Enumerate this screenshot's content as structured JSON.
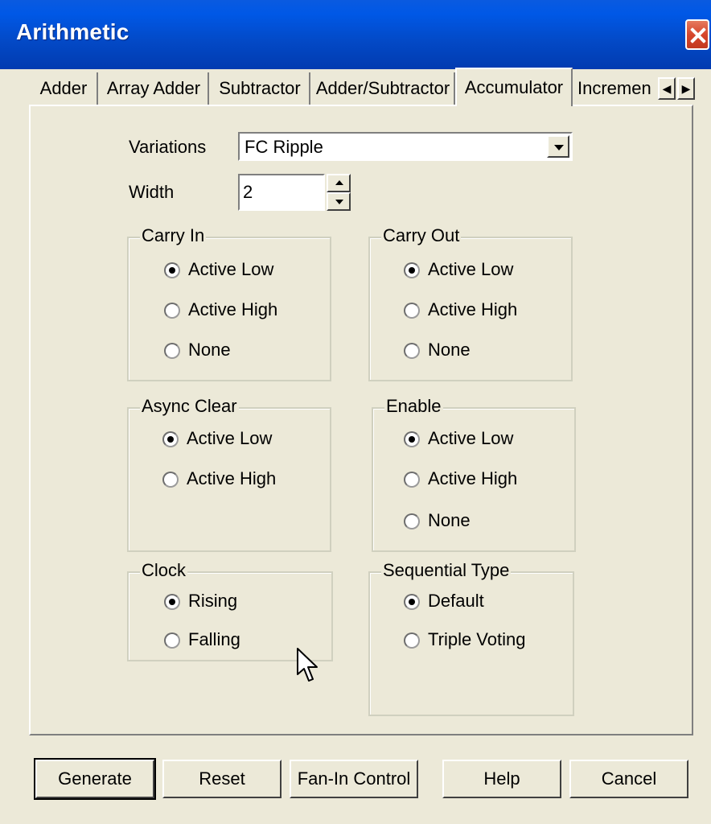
{
  "window": {
    "title": "Arithmetic"
  },
  "tabs": [
    {
      "label": "Adder"
    },
    {
      "label": "Array Adder"
    },
    {
      "label": "Subtractor"
    },
    {
      "label": "Adder/Subtractor"
    },
    {
      "label": "Accumulator",
      "active": true
    },
    {
      "label": "Incremen"
    }
  ],
  "form": {
    "variations_label": "Variations",
    "variations_value": "FC Ripple",
    "width_label": "Width",
    "width_value": "2"
  },
  "groups": {
    "carry_in": {
      "title": "Carry In",
      "options": [
        "Active Low",
        "Active High",
        "None"
      ],
      "selected": "Active Low"
    },
    "carry_out": {
      "title": "Carry Out",
      "options": [
        "Active Low",
        "Active High",
        "None"
      ],
      "selected": "Active Low"
    },
    "async_clear": {
      "title": "Async Clear",
      "options": [
        "Active Low",
        "Active High"
      ],
      "selected": "Active Low"
    },
    "enable": {
      "title": "Enable",
      "options": [
        "Active Low",
        "Active High",
        "None"
      ],
      "selected": "Active Low"
    },
    "clock": {
      "title": "Clock",
      "options": [
        "Rising",
        "Falling"
      ],
      "selected": "Rising"
    },
    "sequential_type": {
      "title": "Sequential Type",
      "options": [
        "Default",
        "Triple Voting"
      ],
      "selected": "Default"
    }
  },
  "buttons": {
    "generate": "Generate",
    "reset": "Reset",
    "fan_in": "Fan-In Control",
    "help": "Help",
    "cancel": "Cancel"
  },
  "colors": {
    "titlebar": "#0349c6",
    "face": "#ece9d8",
    "close": "#d6462c"
  }
}
